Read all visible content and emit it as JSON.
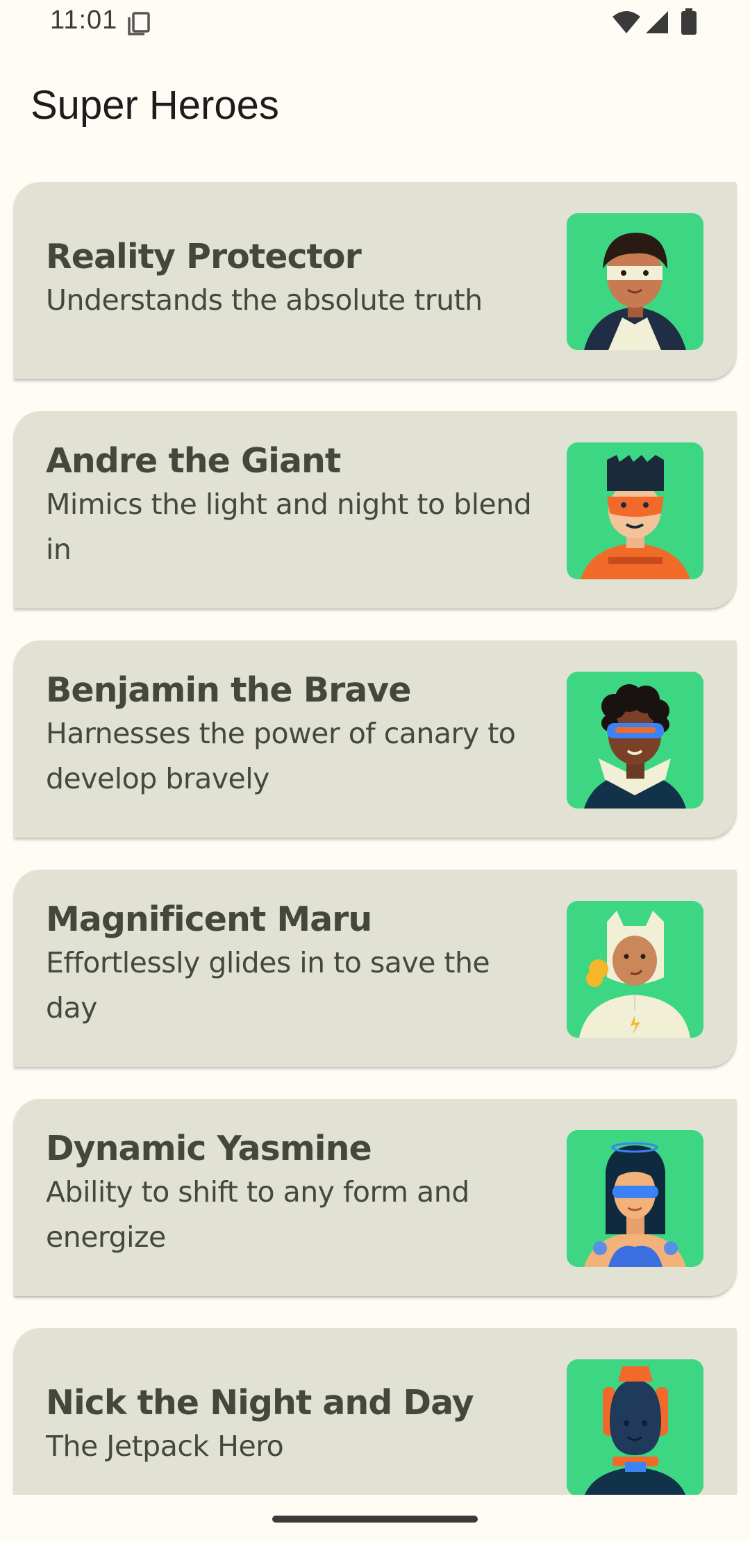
{
  "status_bar": {
    "time": "11:01",
    "icons": [
      "screenshot-icon",
      "wifi-icon",
      "signal-icon",
      "battery-icon"
    ]
  },
  "app_bar": {
    "title": "Super Heroes"
  },
  "colors": {
    "background": "#FFFBF5",
    "card": "#E1E2D4",
    "image_background": "#3DD682",
    "title_text": "#44483C"
  },
  "heroes": [
    {
      "name": "Reality Protector",
      "description": "Understands the absolute truth",
      "avatar": "hero-reality-protector-avatar"
    },
    {
      "name": "Andre the Giant",
      "description": "Mimics the light and night to blend in",
      "avatar": "hero-andre-avatar"
    },
    {
      "name": "Benjamin the Brave",
      "description": "Harnesses the power of canary to develop bravely",
      "avatar": "hero-benjamin-avatar"
    },
    {
      "name": "Magnificent Maru",
      "description": "Effortlessly glides in to save the day",
      "avatar": "hero-maru-avatar"
    },
    {
      "name": "Dynamic Yasmine",
      "description": "Ability to shift to any form and energize",
      "avatar": "hero-yasmine-avatar"
    },
    {
      "name": "Nick the Night and Day",
      "description": "The Jetpack Hero",
      "avatar": "hero-nick-avatar"
    }
  ]
}
